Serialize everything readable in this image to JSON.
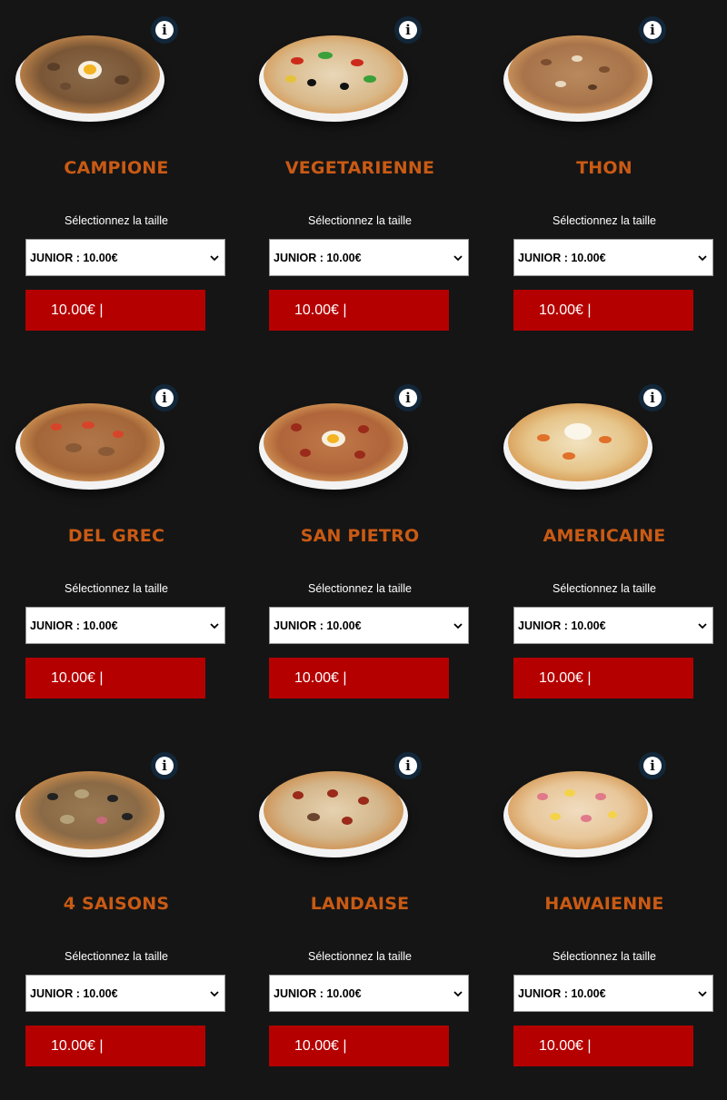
{
  "size_label": "Sélectionnez la taille",
  "info_glyph": "i",
  "pizzas": [
    {
      "name": "CAMPIONE",
      "size_value": "JUNIOR : 10.00€",
      "price_label": "10.00€ |"
    },
    {
      "name": "VEGETARIENNE",
      "size_value": "JUNIOR : 10.00€",
      "price_label": "10.00€ |"
    },
    {
      "name": "THON",
      "size_value": "JUNIOR : 10.00€",
      "price_label": "10.00€ |"
    },
    {
      "name": "DEL GREC",
      "size_value": "JUNIOR : 10.00€",
      "price_label": "10.00€ |"
    },
    {
      "name": "SAN PIETRO",
      "size_value": "JUNIOR : 10.00€",
      "price_label": "10.00€ |"
    },
    {
      "name": "AMERICAINE",
      "size_value": "JUNIOR : 10.00€",
      "price_label": "10.00€ |"
    },
    {
      "name": "4 SAISONS",
      "size_value": "JUNIOR : 10.00€",
      "price_label": "10.00€ |"
    },
    {
      "name": "LANDAISE",
      "size_value": "JUNIOR : 10.00€",
      "price_label": "10.00€ |"
    },
    {
      "name": "HAWAIENNE",
      "size_value": "JUNIOR : 10.00€",
      "price_label": "10.00€ |"
    }
  ],
  "colors": {
    "background": "#151515",
    "title": "#c95a14",
    "price_button": "#b50000",
    "info_button": "#12273a"
  }
}
